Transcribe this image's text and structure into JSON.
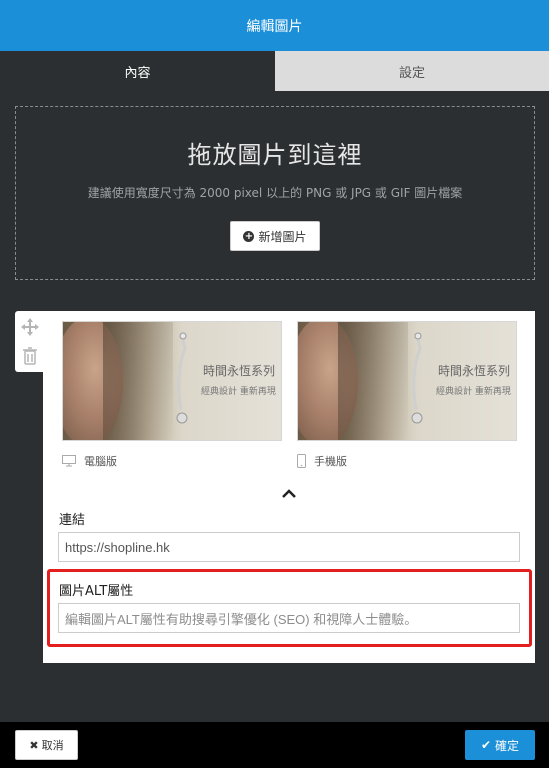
{
  "dialog": {
    "title": "編輯圖片"
  },
  "tabs": [
    {
      "label": "內容",
      "active": true
    },
    {
      "label": "設定",
      "active": false
    }
  ],
  "dropzone": {
    "title": "拖放圖片到這裡",
    "subtitle": "建議使用寬度尺寸為 2000 pixel 以上的 PNG 或 JPG 或 GIF 圖片檔案",
    "add_button_label": "新增圖片"
  },
  "images": {
    "thumbnail_title": "時間永恆系列",
    "thumbnail_subtitle": "經典設計 重新再現",
    "desktop_label": "電腦版",
    "mobile_label": "手機版"
  },
  "link": {
    "label": "連結",
    "value": "https://shopline.hk"
  },
  "alt": {
    "label": "圖片ALT屬性",
    "placeholder": "編輯圖片ALT屬性有助搜尋引擎優化 (SEO) 和視障人士體驗。"
  },
  "footer": {
    "cancel_label": "取消",
    "confirm_label": "確定"
  },
  "colors": {
    "accent": "#1b8fd8",
    "panel": "#2b2f31",
    "highlight": "#e41d1d"
  }
}
